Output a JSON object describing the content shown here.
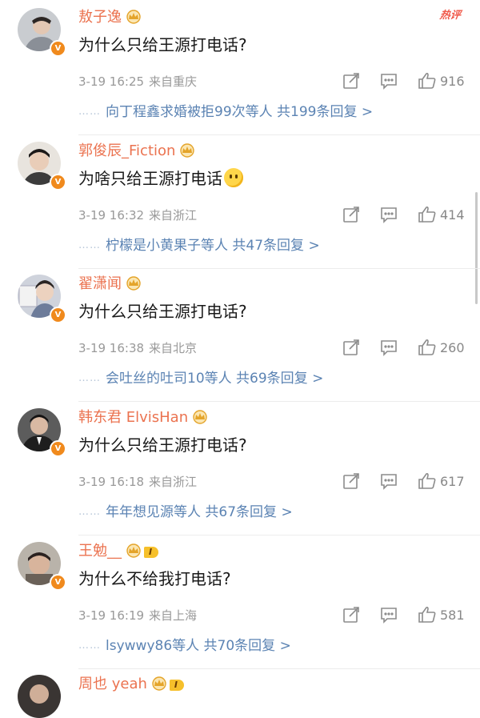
{
  "hot_label": "热评",
  "comments": [
    {
      "name": "敖子逸",
      "text": "为什么只给王源打电话?",
      "time": "3-19 16:25",
      "location": "来自重庆",
      "likes": "916",
      "reply_summary": "向丁程鑫求婚被拒99次等人  共199条回复 >",
      "level": ""
    },
    {
      "name": "郭俊辰_Fiction",
      "text": "为啥只给王源打电话",
      "time": "3-19 16:32",
      "location": "来自浙江",
      "likes": "414",
      "reply_summary": "柠檬是小黄果子等人  共47条回复 >",
      "level": ""
    },
    {
      "name": "翟潇闻",
      "text": "为什么只给王源打电话?",
      "time": "3-19 16:38",
      "location": "来自北京",
      "likes": "260",
      "reply_summary": "会吐丝的吐司10等人  共69条回复 >",
      "level": ""
    },
    {
      "name": "韩东君 ElvisHan",
      "text": "为什么只给王源打电话?",
      "time": "3-19 16:18",
      "location": "来自浙江",
      "likes": "617",
      "reply_summary": "年年想见源等人  共67条回复 >",
      "level": ""
    },
    {
      "name": "王勉__",
      "text": "为什么不给我打电话?",
      "time": "3-19 16:19",
      "location": "来自上海",
      "likes": "581",
      "reply_summary": "lsywwy86等人  共70条回复 >",
      "level": "I"
    },
    {
      "name": "周也 yeah",
      "text": "",
      "time": "",
      "location": "",
      "likes": "",
      "reply_summary": "",
      "level": "I"
    }
  ],
  "icons": {
    "share": "edit-share-icon",
    "reply": "comment-bubble-icon",
    "like": "thumbs-up-icon",
    "badge": "crown-badge-icon",
    "verified": "verified-v-icon"
  },
  "colors": {
    "name": "#eb7350",
    "link": "#5b83b3",
    "meta": "#999999",
    "verified": "#f08a1d"
  }
}
